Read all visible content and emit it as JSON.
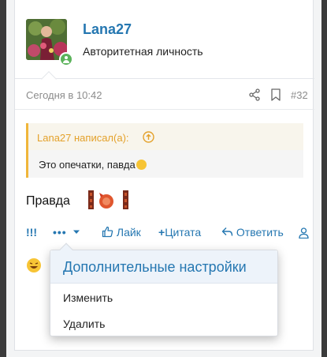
{
  "post": {
    "username": "Lana27",
    "user_title": "Авторитетная личность",
    "date": "Сегодня в 10:42",
    "number": "#32",
    "quote": {
      "author_line": "Lana27 написал(а):",
      "text": "Это опечатки, павда"
    },
    "body_text": "Правда"
  },
  "actions": {
    "exclaim_label": "!!!",
    "more_label": "•••",
    "like_label": "Лайк",
    "quote_label": "Цитата",
    "reply_label": "Ответить"
  },
  "dropdown": {
    "title": "Дополнительные настройки",
    "items": [
      "Изменить",
      "Удалить"
    ]
  },
  "colors": {
    "link": "#2577b1",
    "quote_accent": "#f0b63a",
    "online": "#5bb35b"
  },
  "icons": [
    "share-icon",
    "bookmark-icon",
    "quote-jump-icon",
    "thumbs-up-icon",
    "plus-icon",
    "reply-arrow-icon",
    "user-icon",
    "chevron-down-icon",
    "laughing-emoji-icon",
    "online-status-icon"
  ]
}
